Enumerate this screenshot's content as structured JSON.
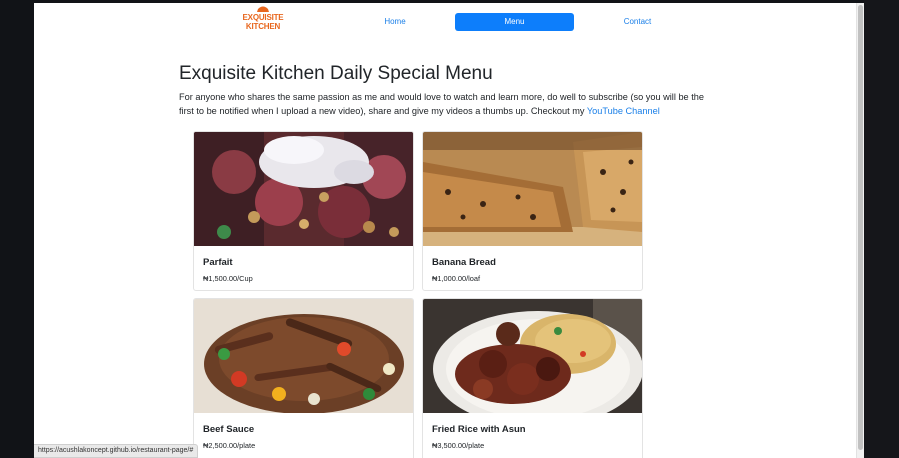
{
  "nav": {
    "logo_line1": "EXQUISITE",
    "logo_line2": "KITCHEN",
    "home": "Home",
    "menu": "Menu",
    "contact": "Contact"
  },
  "main": {
    "title": "Exquisite Kitchen Daily Special Menu",
    "intro": "For anyone who shares the same passion as me and would love to watch and learn more, do well to subscribe (so you will be the first to be notified when I upload a new video), share and give my videos a thumbs up. Checkout my",
    "youtube_link": "YouTube Channel"
  },
  "menu_items": [
    {
      "name": "Parfait",
      "price": "₦1,500.00/Cup",
      "image": "parfait-photo"
    },
    {
      "name": "Banana Bread",
      "price": "₦1,000.00/loaf",
      "image": "banana-bread-photo"
    },
    {
      "name": "Beef Sauce",
      "price": "₦2,500.00/plate",
      "image": "beef-sauce-photo"
    },
    {
      "name": "Fried Rice with Asun",
      "price": "₦3,500.00/plate",
      "image": "fried-rice-photo"
    }
  ],
  "status_bar": {
    "url": "https://acushlakoncept.github.io/restaurant-page/#"
  },
  "colors": {
    "accent": "#0d7efb",
    "link": "#1a7fe8",
    "logo": "#e8671e"
  }
}
